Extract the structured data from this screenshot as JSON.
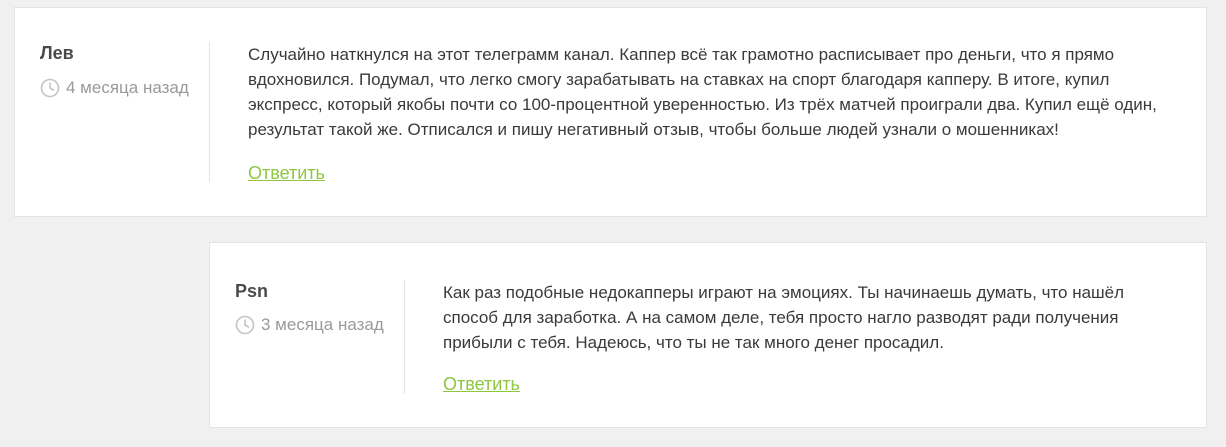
{
  "comments": [
    {
      "author": "Лев",
      "date": "4 месяца назад",
      "text": "Случайно наткнулся на этот телеграмм канал. Каппер всё так грамотно расписывает про деньги, что я прямо вдохновился. Подумал, что легко смогу зарабатывать на ставках на спорт благодаря капперу. В итоге, купил экспресс, который якобы почти со 100-процентной уверенностью. Из трёх матчей проиграли два. Купил ещё один, результат такой же. Отписался и пишу негативный отзыв, чтобы больше людей узнали о мошенниках!",
      "reply_label": "Ответить"
    },
    {
      "author": "Psn",
      "date": "3 месяца назад",
      "text": "Как раз подобные недокапперы играют на эмоциях. Ты начинаешь думать, что нашёл способ для заработка. А на самом деле, тебя просто нагло разводят ради получения прибыли с тебя. Надеюсь, что ты не так много денег просадил.",
      "reply_label": "Ответить"
    }
  ],
  "colors": {
    "accent": "#8dc63f",
    "text": "#3a3a3a",
    "muted": "#9a9a9a",
    "border": "#e3e3e3",
    "background": "#f0f0f0"
  },
  "icons": {
    "date": "clock-icon"
  }
}
